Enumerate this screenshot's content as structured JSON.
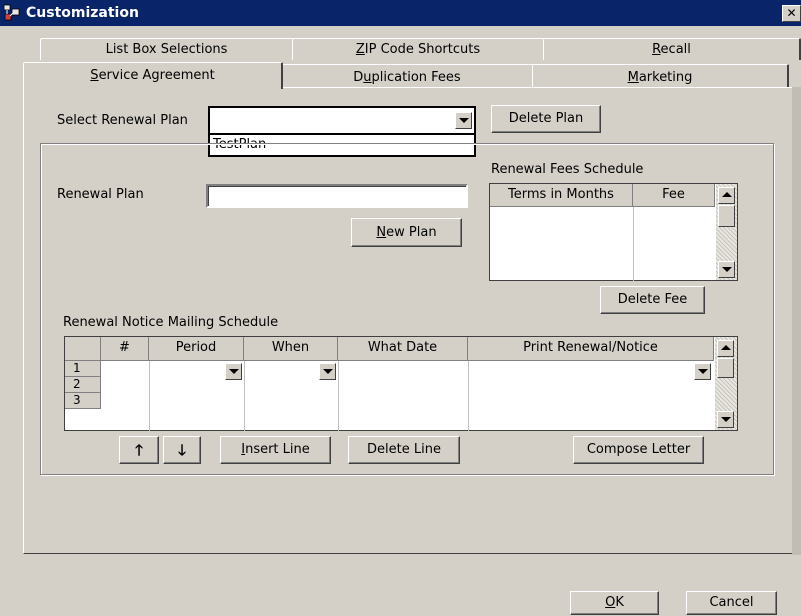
{
  "window": {
    "title": "Customization",
    "close_label": "✕"
  },
  "icons": {
    "app": "customization-app-icon",
    "close": "close-icon",
    "up": "arrow-up-icon",
    "down": "arrow-down-icon"
  },
  "tabs": {
    "back_row": [
      {
        "label": "List Box Selections"
      },
      {
        "label_underlined": "Z",
        "label_rest": "IP Code Shortcuts"
      },
      {
        "label_underlined": "R",
        "label_rest": "ecall"
      }
    ],
    "front_row": [
      {
        "label_underlined": "S",
        "label_rest": "ervice Agreement",
        "active": true
      },
      {
        "label_pre": "D",
        "label_underlined": "u",
        "label_rest": "plication Fees"
      },
      {
        "label_underlined": "M",
        "label_rest": "arketing"
      }
    ]
  },
  "renewal_select": {
    "label": "Select Renewal Plan",
    "value": "",
    "options": [
      "TestPlan"
    ],
    "delete_label": "Delete Plan"
  },
  "renewal_plan": {
    "label": "Renewal Plan",
    "value": "",
    "new_label_underlined": "N",
    "new_label_rest": "ew Plan"
  },
  "fees_schedule": {
    "title": "Renewal Fees Schedule",
    "columns": [
      "Terms in Months",
      "Fee"
    ],
    "rows": [],
    "delete_label": "Delete Fee"
  },
  "mailing_schedule": {
    "title": "Renewal Notice Mailing Schedule",
    "columns": [
      "#",
      "Period",
      "When",
      "What Date",
      "Print Renewal/Notice"
    ],
    "rows": [
      {
        "num": "1",
        "period": "",
        "when": "",
        "what_date": "",
        "print": ""
      },
      {
        "num": "2"
      },
      {
        "num": "3"
      }
    ],
    "up_glyph": "🡑",
    "down_glyph": "🡓",
    "insert_label_underlined": "I",
    "insert_label_rest": "nsert Line",
    "delete_label": "Delete Line",
    "compose_label": "Compose Letter"
  },
  "footer": {
    "ok_underlined": "O",
    "ok_rest": "K",
    "cancel_label": "Cancel"
  }
}
